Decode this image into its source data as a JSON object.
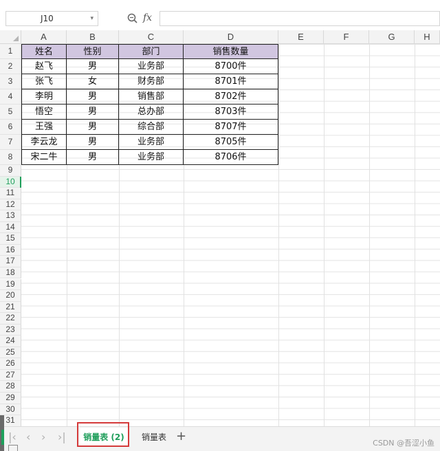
{
  "formula_bar": {
    "name_box": "J10",
    "fx": "fx",
    "formula_value": ""
  },
  "columns": [
    "A",
    "B",
    "C",
    "D",
    "E",
    "F",
    "G",
    "H"
  ],
  "row_numbers": [
    "1",
    "2",
    "3",
    "4",
    "5",
    "6",
    "7",
    "8",
    "9",
    "10",
    "11",
    "12",
    "13",
    "14",
    "15",
    "16",
    "17",
    "18",
    "19",
    "20",
    "21",
    "22",
    "23",
    "24",
    "25",
    "26",
    "27",
    "28",
    "29",
    "30",
    "31"
  ],
  "active_row": "10",
  "table": {
    "header": [
      "姓名",
      "性别",
      "部门",
      "销售数量"
    ],
    "rows": [
      [
        "赵飞",
        "男",
        "业务部",
        "8700件"
      ],
      [
        "张飞",
        "女",
        "财务部",
        "8701件"
      ],
      [
        "李明",
        "男",
        "销售部",
        "8702件"
      ],
      [
        "悟空",
        "男",
        "总办部",
        "8703件"
      ],
      [
        "王强",
        "男",
        "综合部",
        "8707件"
      ],
      [
        "李云龙",
        "男",
        "业务部",
        "8705件"
      ],
      [
        "宋二牛",
        "男",
        "业务部",
        "8706件"
      ]
    ]
  },
  "sheet_tabs": {
    "active": "销量表 (2)",
    "other": "销量表",
    "add": "+"
  },
  "colors": {
    "header_fill": "#d1c6e0",
    "active_green": "#1e9e5a",
    "highlight_red": "#d43a3a"
  },
  "watermark": "CSDN @吾涩小鱼"
}
